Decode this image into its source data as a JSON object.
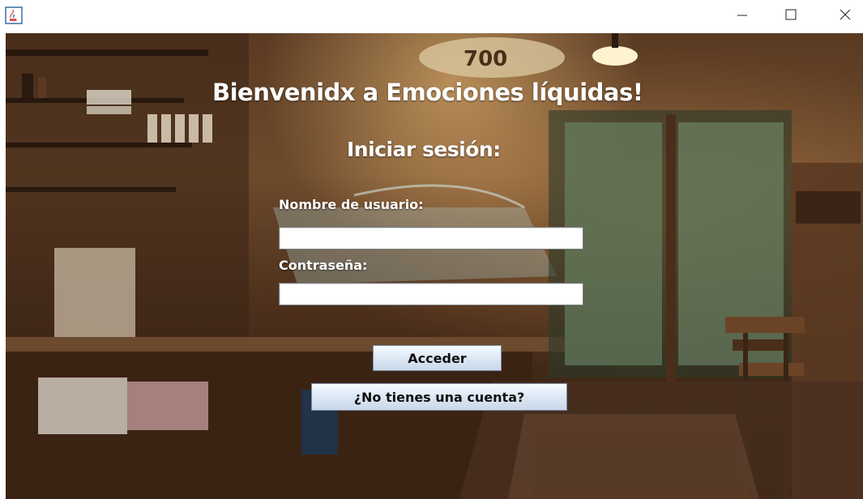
{
  "window": {
    "app_icon": "java-coffee-cup-icon",
    "controls": {
      "minimize": "minimize-icon",
      "maximize": "maximize-icon",
      "close": "close-icon"
    }
  },
  "login": {
    "welcome_title": "Bienvenidx a Emociones líquidas!",
    "subtitle": "Iniciar sesión:",
    "username_label": "Nombre de usuario:",
    "username_value": "",
    "password_label": "Contraseña:",
    "password_value": "",
    "login_button": "Acceder",
    "register_button": "¿No tienes una cuenta?"
  },
  "background": {
    "description_icon": "cafe-interior-background",
    "sign_text": "700"
  },
  "colors": {
    "text": "#ffffff",
    "button_top": "#f7fbff",
    "button_bottom": "#c9d8ea",
    "button_border": "#7a8aa0"
  }
}
